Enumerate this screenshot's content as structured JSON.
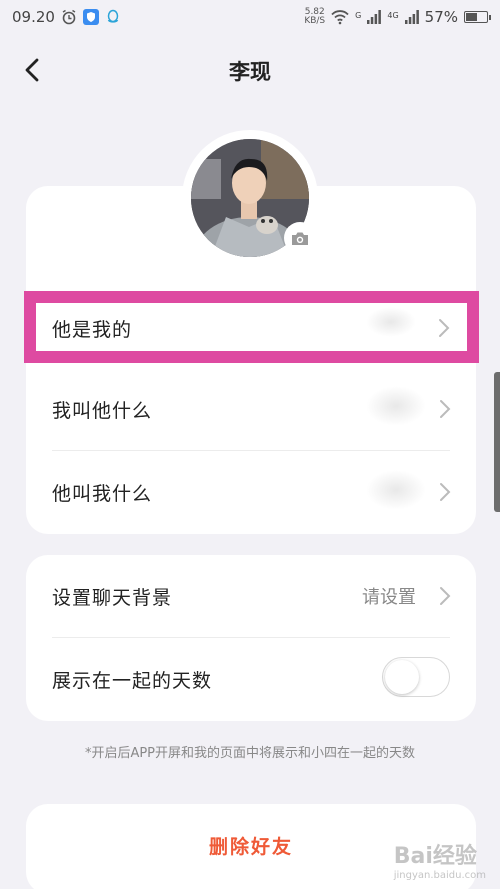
{
  "status_bar": {
    "time": "09.20",
    "net_speed_value": "5.82",
    "net_speed_unit": "KB/S",
    "signal_1": "G",
    "signal_2": "4G",
    "battery_text": "57%",
    "battery_level": 0.57
  },
  "header": {
    "title": "李现",
    "back_icon": "chevron-left-icon"
  },
  "profile": {
    "avatar_icon": "person-avatar",
    "camera_icon": "camera-icon"
  },
  "card1": {
    "rows": [
      {
        "label": "他是我的"
      },
      {
        "label": "我叫他什么"
      },
      {
        "label": "他叫我什么"
      }
    ]
  },
  "card2": {
    "background_label": "设置聊天背景",
    "background_value": "请设置",
    "days_label": "展示在一起的天数",
    "days_toggle_on": false
  },
  "note": "*开启后APP开屏和我的页面中将展示和小四在一起的天数",
  "delete_button": "删除好友",
  "colors": {
    "highlight": "#de4aa1",
    "delete": "#ef5a37",
    "background": "#f2f1f6"
  },
  "watermark": {
    "text": "Bai经验",
    "sub": "jingyan.baidu.com"
  }
}
